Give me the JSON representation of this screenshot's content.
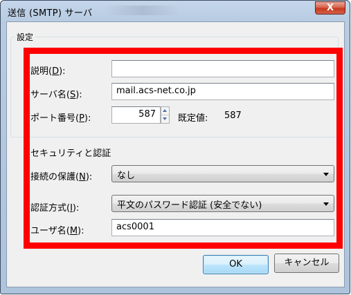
{
  "window": {
    "title": "送信 (SMTP) サーバ",
    "close_label": "X"
  },
  "settings": {
    "group_title": "設定",
    "description": {
      "label": "説明(",
      "mnemonic": "D",
      "label_end": "):",
      "value": ""
    },
    "server_name": {
      "label": "サーバ名(",
      "mnemonic": "S",
      "label_end": "):",
      "value": "mail.acs-net.co.jp"
    },
    "port": {
      "label": "ポート番号(",
      "mnemonic": "P",
      "label_end": "):",
      "value": "587",
      "default_label": "既定値:",
      "default_value": "587"
    }
  },
  "security": {
    "section_title": "セキュリティと認証",
    "connection": {
      "label": "接続の保護(",
      "mnemonic": "N",
      "label_end": "):",
      "selected": "なし"
    },
    "auth_method": {
      "label": "認証方式(",
      "mnemonic": "I",
      "label_end": "):",
      "selected": "平文のパスワード認証 (安全でない)"
    },
    "username": {
      "label": "ユーザ名(",
      "mnemonic": "M",
      "label_end": "):",
      "value": "acs0001"
    }
  },
  "buttons": {
    "ok": "OK",
    "cancel": "キャンセル"
  },
  "colors": {
    "highlight_frame": "#ff0000",
    "dialog_face": "#f0f0f0",
    "title_bar": "#b7cbe2"
  }
}
